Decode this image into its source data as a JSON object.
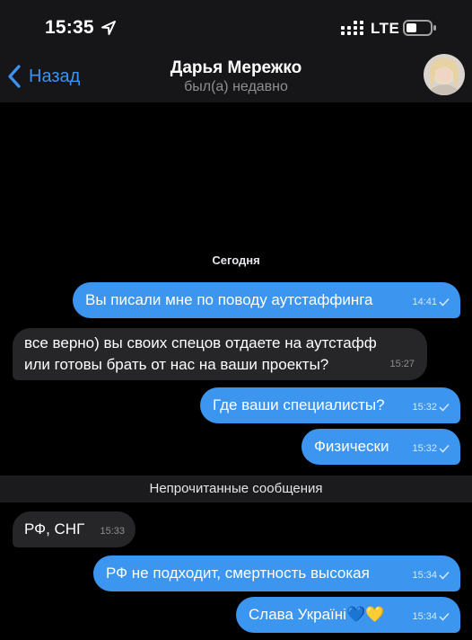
{
  "status_bar": {
    "time": "15:35",
    "network": "LTE",
    "icons": [
      "location-arrow-icon",
      "signal-icon",
      "battery-icon"
    ]
  },
  "nav": {
    "back_label": "Назад",
    "contact_name": "Дарья Мережко",
    "contact_status": "был(а) недавно"
  },
  "chat": {
    "date_label": "Сегодня",
    "unread_label": "Непрочитанные сообщения",
    "messages": [
      {
        "direction": "out",
        "text": "Вы писали мне по поводу аутстаффинга",
        "time": "14:41",
        "read": true
      },
      {
        "direction": "in",
        "text": "все верно) вы своих спецов отдаете на аутстафф\nили готовы брать от нас на ваши проекты?",
        "time": "15:27"
      },
      {
        "direction": "out",
        "text": "Где ваши специалисты?",
        "time": "15:32",
        "read": true
      },
      {
        "direction": "out",
        "text": "Физически",
        "time": "15:32",
        "read": true
      },
      {
        "direction": "in",
        "text": "РФ, СНГ",
        "time": "15:33"
      },
      {
        "direction": "out",
        "text": "РФ не подходит, смертность высокая",
        "time": "15:34",
        "read": true
      },
      {
        "direction": "out",
        "text": "Слава Україні💙💛",
        "time": "15:34",
        "read": true
      }
    ]
  },
  "colors": {
    "accent": "#3c93f5",
    "outgoing_bubble": "#3c96ef",
    "incoming_bubble": "#262628",
    "background": "#000000",
    "header": "#161618"
  }
}
